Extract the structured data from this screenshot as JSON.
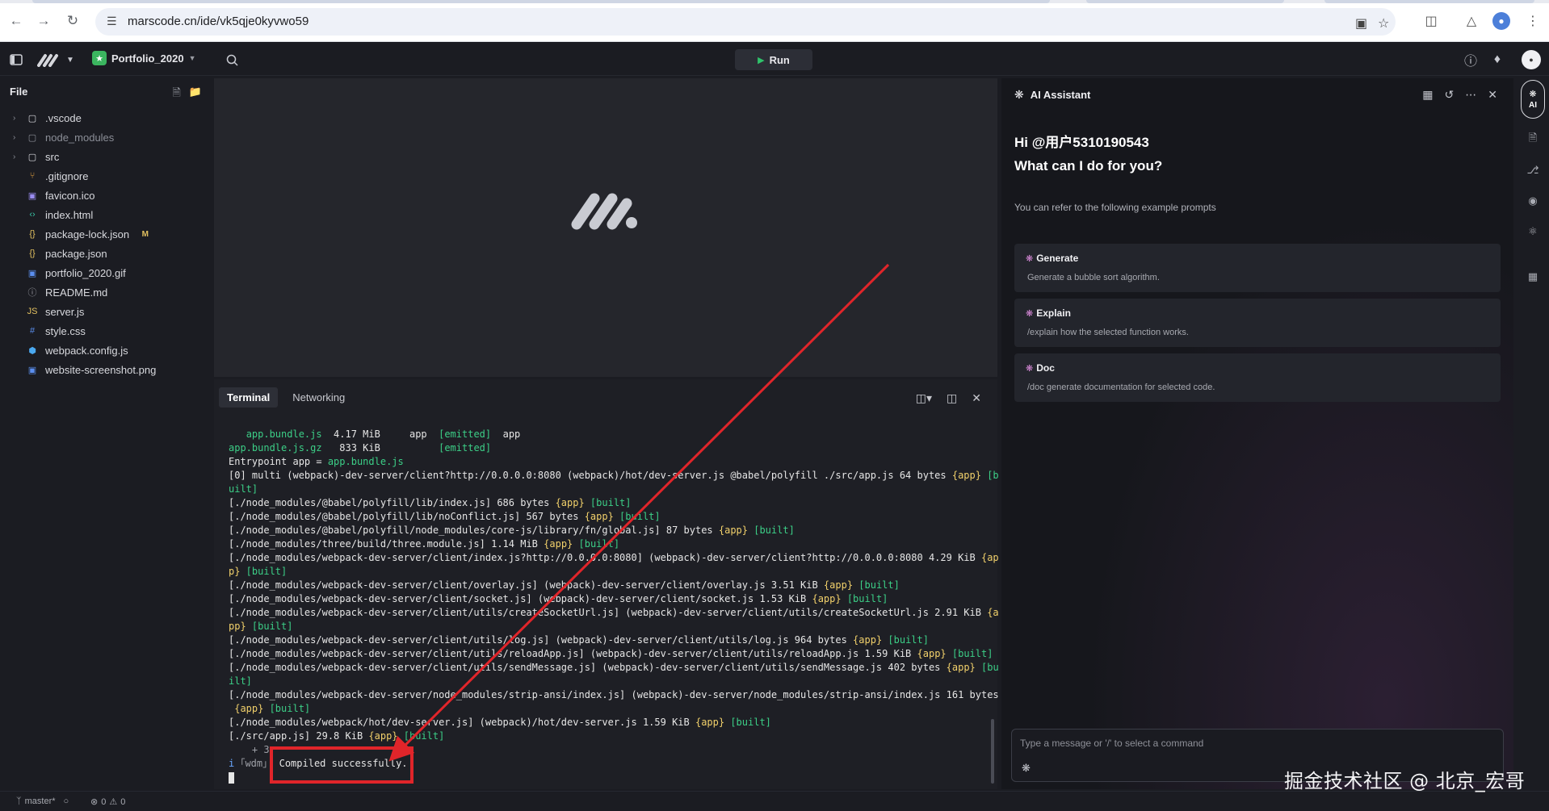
{
  "browser": {
    "url": "marscode.cn/ide/vk5qje0kyvwo59",
    "back_icon": "arrow-left-icon",
    "forward_icon": "arrow-right-icon",
    "reload_icon": "reload-icon"
  },
  "ide": {
    "project_name": "Portfolio_2020",
    "run_label": "Run"
  },
  "sidebar": {
    "header": "File",
    "files": [
      {
        "name": ".vscode",
        "type": "folder",
        "icon": "folder-icon",
        "color": "#d8d9de"
      },
      {
        "name": "node_modules",
        "type": "folder",
        "icon": "folder-icon",
        "muted": true,
        "color": "#8b8e97"
      },
      {
        "name": "src",
        "type": "folder",
        "icon": "folder-icon",
        "color": "#d8d9de"
      },
      {
        "name": ".gitignore",
        "type": "file",
        "icon": "git-icon",
        "color": "#e2a03f"
      },
      {
        "name": "favicon.ico",
        "type": "file",
        "icon": "image-icon",
        "color": "#9a8cf0"
      },
      {
        "name": "index.html",
        "type": "file",
        "icon": "html-icon",
        "color": "#38c2a4"
      },
      {
        "name": "package-lock.json",
        "type": "file",
        "icon": "json-icon",
        "color": "#e2c060",
        "badge": "M"
      },
      {
        "name": "package.json",
        "type": "file",
        "icon": "json-icon",
        "color": "#e2c060"
      },
      {
        "name": "portfolio_2020.gif",
        "type": "file",
        "icon": "image-icon",
        "color": "#5b8ff0"
      },
      {
        "name": "README.md",
        "type": "file",
        "icon": "info-icon",
        "color": "#9a9ca3"
      },
      {
        "name": "server.js",
        "type": "file",
        "icon": "js-icon",
        "color": "#e2c060"
      },
      {
        "name": "style.css",
        "type": "file",
        "icon": "css-icon",
        "color": "#5b8ff0"
      },
      {
        "name": "webpack.config.js",
        "type": "file",
        "icon": "webpack-icon",
        "color": "#4aa8f0"
      },
      {
        "name": "website-screenshot.png",
        "type": "file",
        "icon": "image-icon",
        "color": "#5b8ff0"
      }
    ]
  },
  "terminal": {
    "tabs": [
      "Terminal",
      "Networking"
    ],
    "lines": [
      [
        {
          "t": "   ",
          "c": ""
        },
        {
          "t": "app.bundle.js",
          "c": "t-green"
        },
        {
          "t": "  4.17 MiB     app  ",
          "c": ""
        },
        {
          "t": "[emitted]",
          "c": "t-green"
        },
        {
          "t": "  app",
          "c": ""
        }
      ],
      [
        {
          "t": "app.bundle.js.gz",
          "c": "t-green"
        },
        {
          "t": "   833 KiB          ",
          "c": ""
        },
        {
          "t": "[emitted]",
          "c": "t-green"
        }
      ],
      [
        {
          "t": "Entrypoint app = ",
          "c": ""
        },
        {
          "t": "app.bundle.js",
          "c": "t-green"
        }
      ],
      [
        {
          "t": "[0] multi (webpack)-dev-server/client?http://0.0.0.0:8080 (webpack)/hot/dev-server.js @babel/polyfill ./src/app.js 64 bytes ",
          "c": ""
        },
        {
          "t": "{app}",
          "c": "t-yellow"
        },
        {
          "t": " [b",
          "c": "t-green"
        }
      ],
      [
        {
          "t": "uilt]",
          "c": "t-green"
        }
      ],
      [
        {
          "t": "[./node_modules/@babel/polyfill/lib/index.js] 686 bytes ",
          "c": ""
        },
        {
          "t": "{app}",
          "c": "t-yellow"
        },
        {
          "t": " [built]",
          "c": "t-green"
        }
      ],
      [
        {
          "t": "[./node_modules/@babel/polyfill/lib/noConflict.js] 567 bytes ",
          "c": ""
        },
        {
          "t": "{app}",
          "c": "t-yellow"
        },
        {
          "t": " [built]",
          "c": "t-green"
        }
      ],
      [
        {
          "t": "[./node_modules/@babel/polyfill/node_modules/core-js/library/fn/global.js] 87 bytes ",
          "c": ""
        },
        {
          "t": "{app}",
          "c": "t-yellow"
        },
        {
          "t": " [built]",
          "c": "t-green"
        }
      ],
      [
        {
          "t": "[./node_modules/three/build/three.module.js] 1.14 MiB ",
          "c": ""
        },
        {
          "t": "{app}",
          "c": "t-yellow"
        },
        {
          "t": " [built]",
          "c": "t-green"
        }
      ],
      [
        {
          "t": "[./node_modules/webpack-dev-server/client/index.js?http://0.0.0.0:8080] (webpack)-dev-server/client?http://0.0.0.0:8080 4.29 KiB ",
          "c": ""
        },
        {
          "t": "{ap",
          "c": "t-yellow"
        }
      ],
      [
        {
          "t": "p}",
          "c": "t-yellow"
        },
        {
          "t": " [built]",
          "c": "t-green"
        }
      ],
      [
        {
          "t": "[./node_modules/webpack-dev-server/client/overlay.js] (webpack)-dev-server/client/overlay.js 3.51 KiB ",
          "c": ""
        },
        {
          "t": "{app}",
          "c": "t-yellow"
        },
        {
          "t": " [built]",
          "c": "t-green"
        }
      ],
      [
        {
          "t": "[./node_modules/webpack-dev-server/client/socket.js] (webpack)-dev-server/client/socket.js 1.53 KiB ",
          "c": ""
        },
        {
          "t": "{app}",
          "c": "t-yellow"
        },
        {
          "t": " [built]",
          "c": "t-green"
        }
      ],
      [
        {
          "t": "[./node_modules/webpack-dev-server/client/utils/createSocketUrl.js] (webpack)-dev-server/client/utils/createSocketUrl.js 2.91 KiB ",
          "c": ""
        },
        {
          "t": "{a",
          "c": "t-yellow"
        }
      ],
      [
        {
          "t": "pp}",
          "c": "t-yellow"
        },
        {
          "t": " [built]",
          "c": "t-green"
        }
      ],
      [
        {
          "t": "[./node_modules/webpack-dev-server/client/utils/log.js] (webpack)-dev-server/client/utils/log.js 964 bytes ",
          "c": ""
        },
        {
          "t": "{app}",
          "c": "t-yellow"
        },
        {
          "t": " [built]",
          "c": "t-green"
        }
      ],
      [
        {
          "t": "[./node_modules/webpack-dev-server/client/utils/reloadApp.js] (webpack)-dev-server/client/utils/reloadApp.js 1.59 KiB ",
          "c": ""
        },
        {
          "t": "{app}",
          "c": "t-yellow"
        },
        {
          "t": " [built]",
          "c": "t-green"
        }
      ],
      [
        {
          "t": "[./node_modules/webpack-dev-server/client/utils/sendMessage.js] (webpack)-dev-server/client/utils/sendMessage.js 402 bytes ",
          "c": ""
        },
        {
          "t": "{app}",
          "c": "t-yellow"
        },
        {
          "t": " [bu",
          "c": "t-green"
        }
      ],
      [
        {
          "t": "ilt]",
          "c": "t-green"
        }
      ],
      [
        {
          "t": "[./node_modules/webpack-dev-server/node_modules/strip-ansi/index.js] (webpack)-dev-server/node_modules/strip-ansi/index.js 161 bytes",
          "c": ""
        }
      ],
      [
        {
          "t": " {app}",
          "c": "t-yellow"
        },
        {
          "t": " [built]",
          "c": "t-green"
        }
      ],
      [
        {
          "t": "[./node_modules/webpack/hot/dev-server.js] (webpack)/hot/dev-server.js 1.59 KiB ",
          "c": ""
        },
        {
          "t": "{app}",
          "c": "t-yellow"
        },
        {
          "t": " [built]",
          "c": "t-green"
        }
      ],
      [
        {
          "t": "[./src/app.js] 29.8 KiB ",
          "c": ""
        },
        {
          "t": "{app}",
          "c": "t-yellow"
        },
        {
          "t": " [built]",
          "c": "t-green"
        }
      ],
      [
        {
          "t": "    + 3",
          "c": "t-dim"
        }
      ],
      [
        {
          "t": "i",
          "c": "t-blue"
        },
        {
          "t": " ｢wdm｣: ",
          "c": "t-dim"
        },
        {
          "t": "Compiled successfully.",
          "c": ""
        }
      ]
    ]
  },
  "ai": {
    "title": "AI Assistant",
    "greeting_line1": "Hi @用户5310190543",
    "greeting_line2": "What can I do for you?",
    "hint": "You can refer to the following example prompts",
    "prompts": [
      {
        "title": "Generate",
        "desc": "Generate a bubble sort algorithm."
      },
      {
        "title": "Explain",
        "desc": "/explain how the selected function works."
      },
      {
        "title": "Doc",
        "desc": "/doc generate documentation for selected code."
      }
    ],
    "input_placeholder": "Type a message or '/' to select a command",
    "side_tab_label": "AI"
  },
  "status": {
    "branch": "master*",
    "errors": "0",
    "warnings": "0"
  },
  "watermark": "掘金技术社区 @ 北京_宏哥",
  "colors": {
    "run_green": "#2fc36b",
    "annotation_red": "#e0252a",
    "accent_terminal_green": "#3ccf87",
    "accent_terminal_yellow": "#f2d16b"
  }
}
